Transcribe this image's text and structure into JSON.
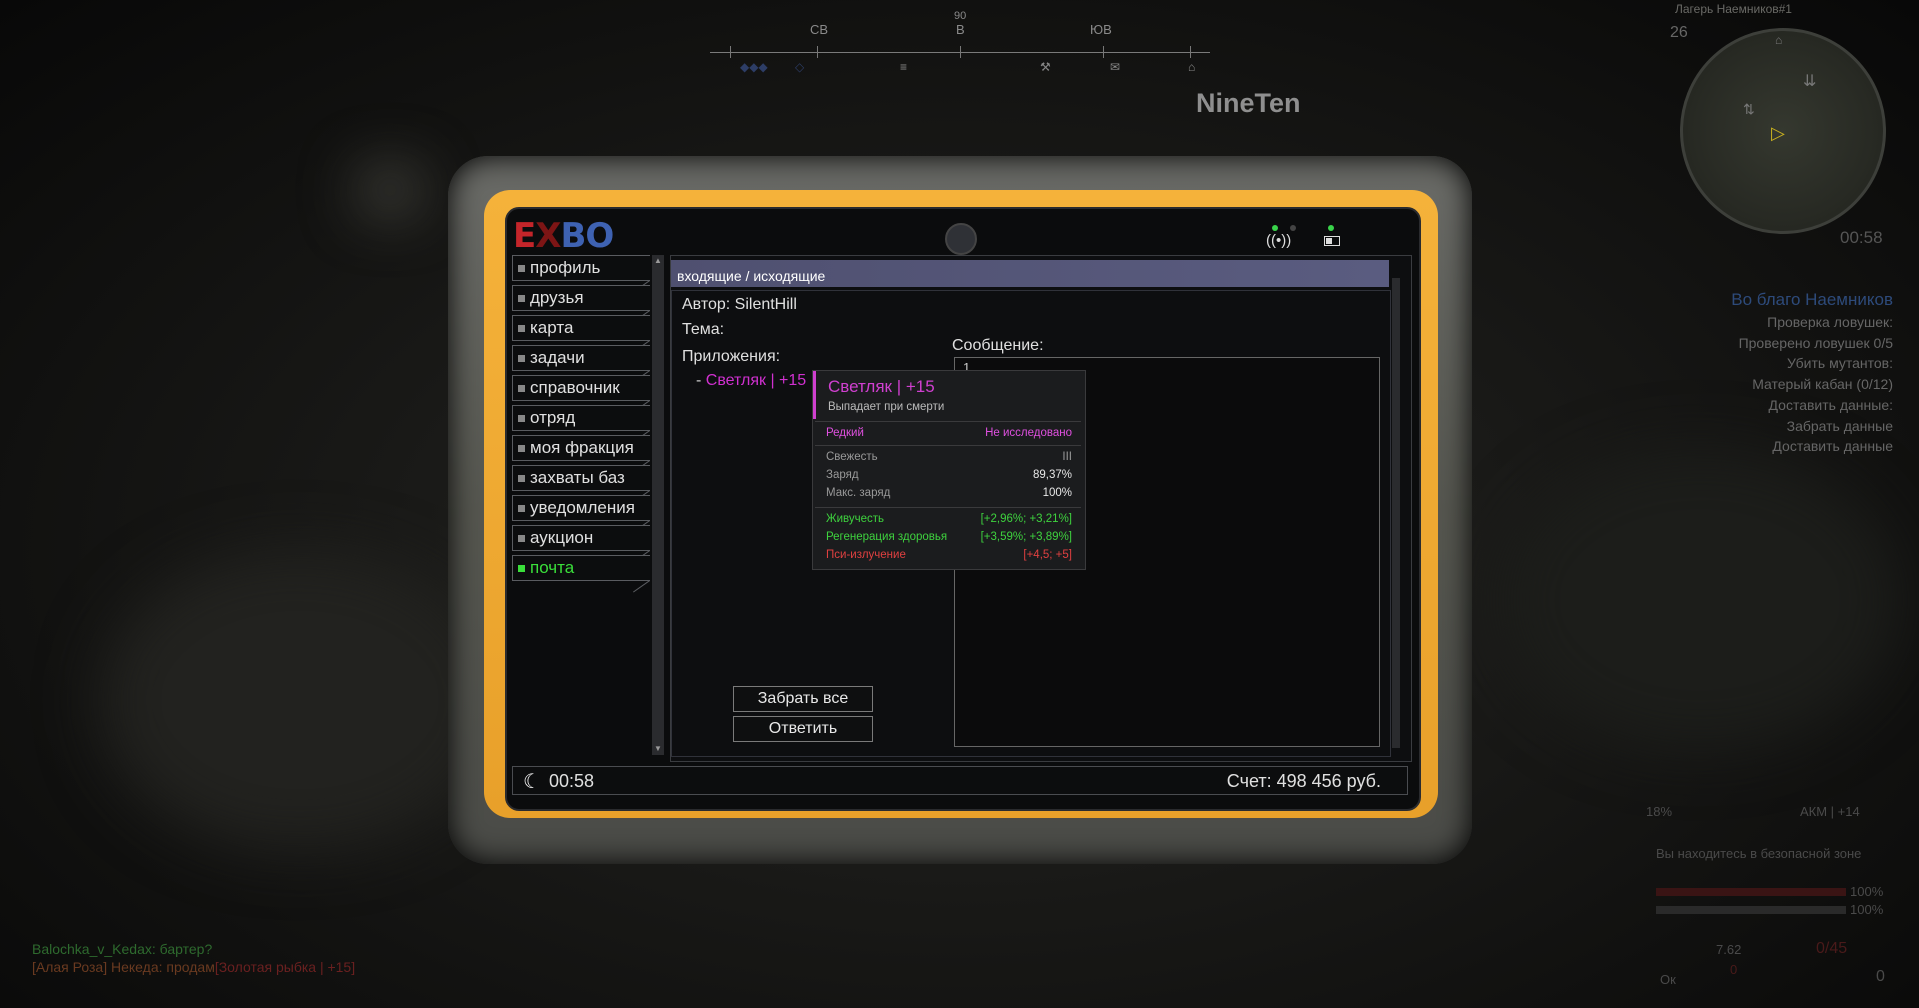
{
  "hud": {
    "compass": {
      "labels": [
        "СВ",
        "В",
        "ЮВ"
      ],
      "degree": "90"
    },
    "player_name": "NineTen",
    "minimap": {
      "location": "Лагерь Наемников#1",
      "number": "26",
      "time": "00:58"
    },
    "quest": {
      "title": "Во благо Наемников",
      "lines": [
        "Проверка ловушек:",
        "Проверено ловушек 0/5",
        "Убить мутантов:",
        "Матерый кабан (0/12)",
        "Доставить данные:",
        "Забрать данные",
        "Доставить данные"
      ]
    },
    "chat": [
      {
        "name": "Balochka_v_Kedax:",
        "text": " бартер?"
      },
      {
        "name": "[Алая Роза] Некеда:",
        "text": " продам",
        "item": "[Золотая рыбка | +15]"
      }
    ],
    "bottom_right": {
      "weapon_pct": "18%",
      "weapon": "АКМ | +14",
      "safe_zone": "Вы находитесь в безопасной зоне",
      "hp": "100%",
      "stamina": "100%",
      "caliber": "7.62",
      "ammo": "0/45",
      "zero": "0",
      "ok": "Ок",
      "grenades": "0"
    }
  },
  "tablet": {
    "logo": {
      "e": "E",
      "x": "X",
      "bo": "BO"
    },
    "nav": [
      {
        "label": "профиль",
        "active": false
      },
      {
        "label": "друзья",
        "active": false
      },
      {
        "label": "карта",
        "active": false
      },
      {
        "label": "задачи",
        "active": false
      },
      {
        "label": "справочник",
        "active": false
      },
      {
        "label": "отряд",
        "active": false
      },
      {
        "label": "моя фракция",
        "active": false
      },
      {
        "label": "захваты баз",
        "active": false
      },
      {
        "label": "уведомления",
        "active": false
      },
      {
        "label": "аукцион",
        "active": false
      },
      {
        "label": "почта",
        "active": true
      }
    ],
    "mail": {
      "tab_incoming": "входящие",
      "tab_sep": "/",
      "tab_outgoing": "исходящие",
      "author": "Автор: SilentHill",
      "subject": "Тема:",
      "attachments_label": "Приложения:",
      "attachment_dash": "-",
      "attachment": "Светляк | +15",
      "message_label": "Сообщение:",
      "message_value": "1",
      "take_all": "Забрать все",
      "reply": "Ответить"
    },
    "tooltip": {
      "title": "Светляк | +15",
      "subtitle": "Выпадает при смерти",
      "rarity": "Редкий",
      "research": "Не исследовано",
      "stats": [
        {
          "name": "Свежесть",
          "value": "III"
        },
        {
          "name": "Заряд",
          "value": "89,37%"
        },
        {
          "name": "Макс. заряд",
          "value": "100%"
        }
      ],
      "effects": [
        {
          "name": "Живучесть",
          "value": "[+2,96%; +3,21%]",
          "color": "#3ed23e"
        },
        {
          "name": "Регенерация здоровья",
          "value": "[+3,59%; +3,89%]",
          "color": "#3ed23e"
        },
        {
          "name": "Пси-излучение",
          "value": "[+4,5; +5]",
          "color": "#e04040"
        }
      ]
    },
    "footer": {
      "time": "00:58",
      "account": "Счет: 498 456 руб."
    }
  }
}
